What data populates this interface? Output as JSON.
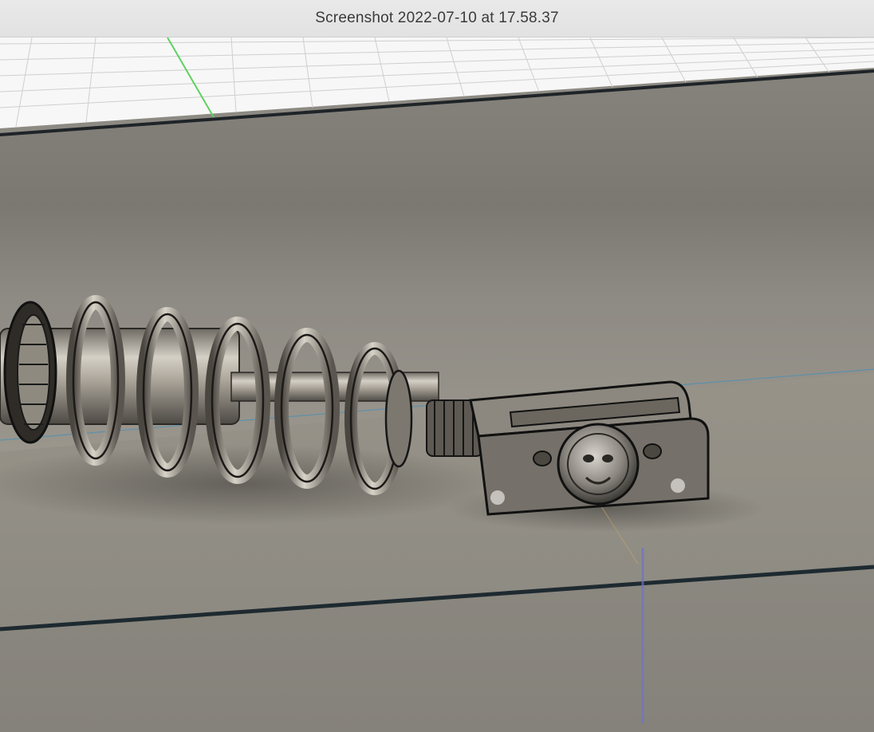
{
  "window": {
    "title": "Screenshot 2022-07-10 at 17.58.37"
  },
  "viewport": {
    "content": "3d-cad-model-view",
    "grid_visible": true,
    "colors": {
      "grid_background": "#f7f7f7",
      "grid_lines": "#c9c9c9",
      "y_axis": "#5fd15f",
      "z_axis": "#6f73c9",
      "box_face": "#8e8b84",
      "box_edge": "#2a2f33",
      "metal": "#a19c92",
      "sketch_line": "#4f8fb3"
    }
  }
}
